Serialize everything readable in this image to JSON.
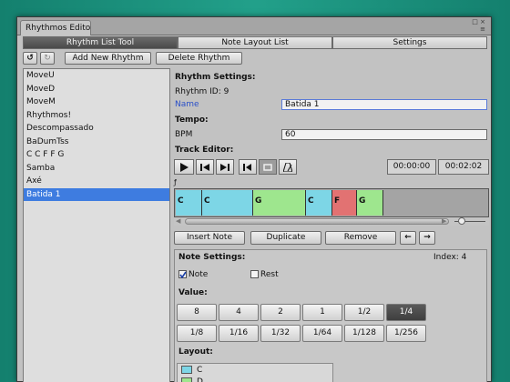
{
  "window": {
    "title": "Rhythmos Edito",
    "controls": "□ ×\n≡"
  },
  "tabs": [
    "Rhythm List Tool",
    "Note Layout List",
    "Settings"
  ],
  "toolbar": {
    "undo": "↺",
    "redo": "↻",
    "add": "Add New Rhythm",
    "delete": "Delete Rhythm"
  },
  "rhythms": [
    "MoveU",
    "MoveD",
    "MoveM",
    "Rhythmos!",
    "Descompassado",
    "BaDumTss",
    "C C F F G",
    "Samba",
    "Axé",
    "Batida 1"
  ],
  "selected_rhythm": 9,
  "settings": {
    "heading": "Rhythm Settings:",
    "id_label": "Rhythm ID: 9",
    "name_label": "Name",
    "name_value": "Batida 1"
  },
  "tempo": {
    "heading": "Tempo:",
    "bpm_label": "BPM",
    "bpm_value": "60"
  },
  "track": {
    "heading": "Track Editor:",
    "time_start": "00:00:00",
    "time_end": "00:02:02",
    "marker": "ƒ"
  },
  "notes": [
    {
      "label": "C",
      "color": "#7dd6e6"
    },
    {
      "label": "C",
      "color": "#7dd6e6"
    },
    {
      "label": "G",
      "color": "#9ee68e"
    },
    {
      "label": "C",
      "color": "#7dd6e6"
    },
    {
      "label": "F",
      "color": "#e27272"
    },
    {
      "label": "G",
      "color": "#9ee68e"
    }
  ],
  "actions": {
    "insert": "Insert Note",
    "duplicate": "Duplicate",
    "remove": "Remove",
    "left": "←",
    "right": "→"
  },
  "note_settings": {
    "heading": "Note Settings:",
    "index": "Index: 4",
    "note_label": "Note",
    "rest_label": "Rest",
    "note_checked": true,
    "rest_checked": false,
    "value_heading": "Value:",
    "layout_heading": "Layout:"
  },
  "values": [
    "8",
    "4",
    "2",
    "1",
    "1/2",
    "1/4",
    "1/8",
    "1/16",
    "1/32",
    "1/64",
    "1/128",
    "1/256"
  ],
  "selected_value": "1/4",
  "layout_items": [
    {
      "label": "C",
      "color": "#7dd6e6"
    },
    {
      "label": "D",
      "color": "#9ee68e"
    }
  ]
}
